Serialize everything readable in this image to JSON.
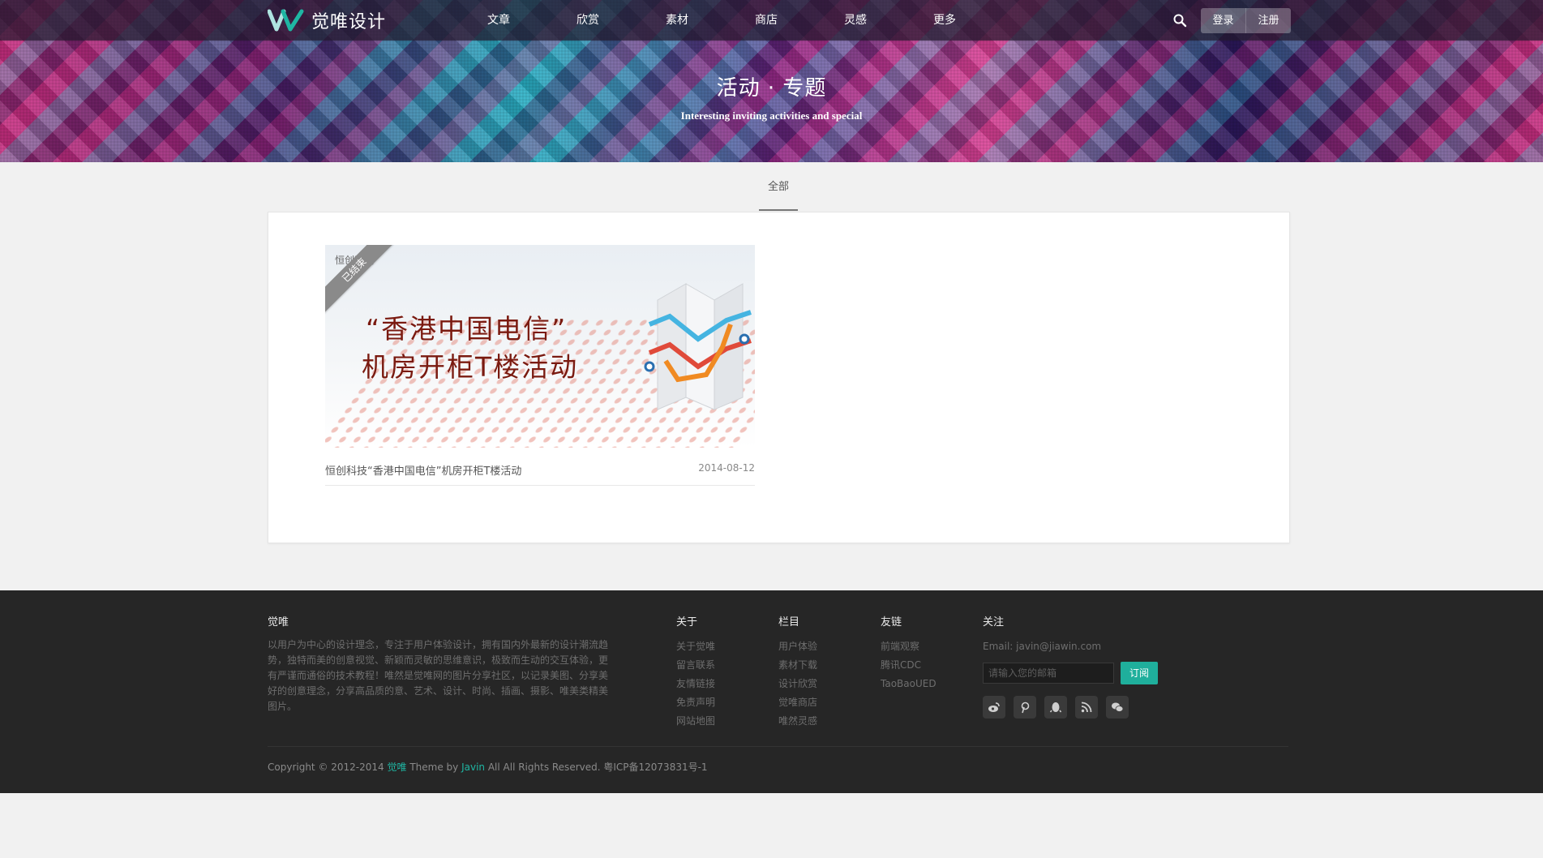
{
  "header": {
    "logo_text": "觉唯设计",
    "nav": [
      "文章",
      "欣赏",
      "素材",
      "商店",
      "灵感",
      "更多"
    ],
    "login_label": "登录",
    "register_label": "注册"
  },
  "hero": {
    "title": "活动 · 专题",
    "subtitle": "Interesting inviting activities and special"
  },
  "filter": {
    "active_tab": "全部"
  },
  "post": {
    "ribbon": "已结束",
    "thumb_brand": "恒创科技",
    "thumb_line1": "“香港中国电信”",
    "thumb_line2": "机房开柜T楼活动",
    "title": "恒创科技“香港中国电信”机房开柜T楼活动",
    "date": "2014-08-12"
  },
  "footer": {
    "about": {
      "heading": "觉唯",
      "text": "以用户为中心的设计理念，专注于用户体验设计，拥有国内外最新的设计潮流趋势，独特而美的创意视觉、新颖而灵敏的思维意识，极致而生动的交互体验，更有严谨而通俗的技术教程！唯然是觉唯网的图片分享社区，以记录美图、分享美好的创意理念，分享高品质的意、艺术、设计、时尚、插画、摄影、唯美类精美图片。"
    },
    "columns": [
      {
        "heading": "关于",
        "links": [
          "关于觉唯",
          "留言联系",
          "友情链接",
          "免责声明",
          "网站地图"
        ]
      },
      {
        "heading": "栏目",
        "links": [
          "用户体验",
          "素材下载",
          "设计欣赏",
          "觉唯商店",
          "唯然灵感"
        ]
      },
      {
        "heading": "友链",
        "links": [
          "前端观察",
          "腾讯CDC",
          "TaoBaoUED"
        ]
      }
    ],
    "follow": {
      "heading": "关注",
      "email": "Email: javin@jiawin.com",
      "placeholder": "请输入您的邮箱",
      "subscribe_label": "订阅",
      "icons": [
        "weibo-icon",
        "pinterest-icon",
        "qq-icon",
        "rss-icon",
        "wechat-icon"
      ]
    },
    "copyright": {
      "prefix": "Copyright © 2012-2014 ",
      "site": "觉唯",
      "middle": " Theme by ",
      "author": "Javin",
      "suffix": " All All Rights Reserved. 粤ICP备12073831号-1"
    }
  },
  "colors": {
    "accent": "#1faf9c",
    "footer_bg": "#262626",
    "page_bg": "#f1f1f1"
  }
}
